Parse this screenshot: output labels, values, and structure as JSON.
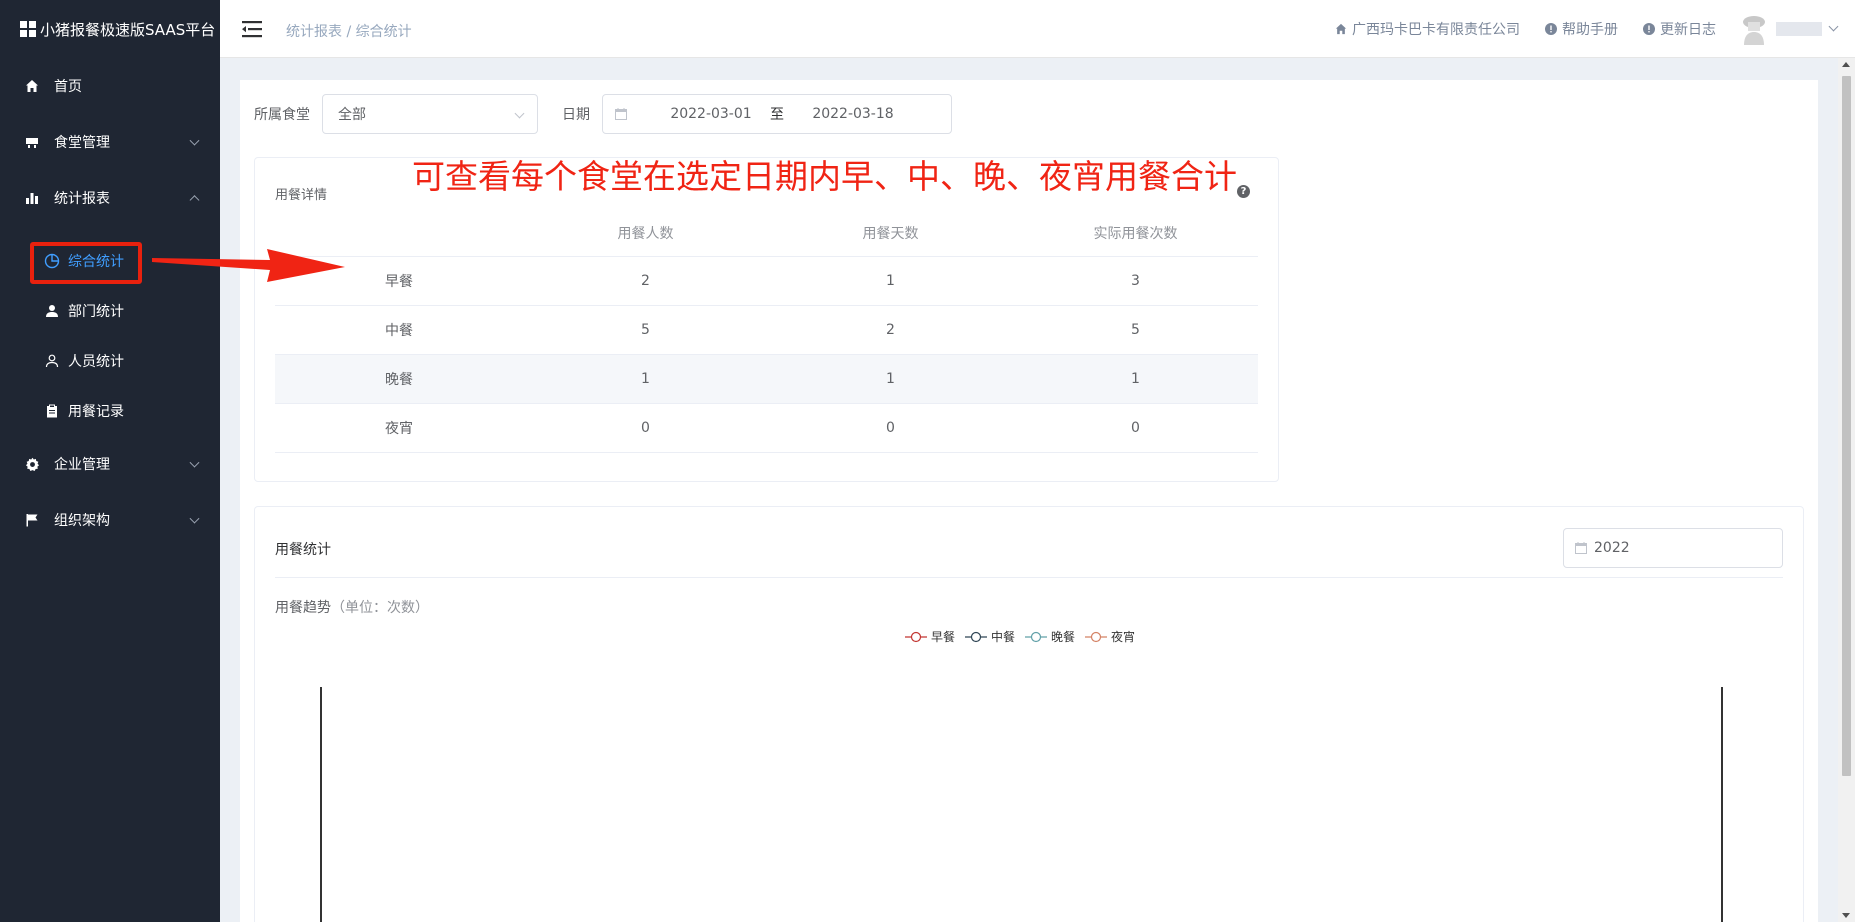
{
  "app": {
    "title": "小猪报餐极速版SAAS平台"
  },
  "sidebar": {
    "items": [
      {
        "label": "首页",
        "icon": "home-icon"
      },
      {
        "label": "食堂管理",
        "icon": "canteen-icon"
      },
      {
        "label": "统计报表",
        "icon": "bar-chart-icon"
      },
      {
        "label": "企业管理",
        "icon": "gear-icon"
      },
      {
        "label": "组织架构",
        "icon": "flag-icon"
      }
    ],
    "subitems": [
      {
        "label": "综合统计",
        "icon": "pie-chart-icon",
        "active": true
      },
      {
        "label": "部门统计",
        "icon": "user-filled-icon"
      },
      {
        "label": "人员统计",
        "icon": "user-outline-icon"
      },
      {
        "label": "用餐记录",
        "icon": "clipboard-icon"
      }
    ]
  },
  "header": {
    "breadcrumb": "统计报表 / 综合统计",
    "company": "广西玛卡巴卡有限责任公司",
    "help": "帮助手册",
    "changelog": "更新日志"
  },
  "filters": {
    "canteen_label": "所属食堂",
    "canteen_value": "全部",
    "date_label": "日期",
    "date_start": "2022-03-01",
    "date_sep": "至",
    "date_end": "2022-03-18"
  },
  "annotation": "可查看每个食堂在选定日期内早、中、晚、夜宵用餐合计",
  "detail": {
    "title": "用餐详情",
    "columns": [
      "",
      "用餐人数",
      "用餐天数",
      "实际用餐次数"
    ],
    "rows": [
      {
        "meal": "早餐",
        "people": "2",
        "days": "1",
        "times": "3"
      },
      {
        "meal": "中餐",
        "people": "5",
        "days": "2",
        "times": "5"
      },
      {
        "meal": "晚餐",
        "people": "1",
        "days": "1",
        "times": "1"
      },
      {
        "meal": "夜宵",
        "people": "0",
        "days": "0",
        "times": "0"
      }
    ]
  },
  "stats": {
    "title": "用餐统计",
    "year": "2022",
    "chart_title": "用餐趋势",
    "chart_unit": "（单位：次数）",
    "legend": [
      {
        "name": "早餐",
        "color": "#c23531"
      },
      {
        "name": "中餐",
        "color": "#2f4554"
      },
      {
        "name": "晚餐",
        "color": "#61a0a8"
      },
      {
        "name": "夜宵",
        "color": "#d48265"
      }
    ]
  },
  "colors": {
    "sidebar_bg": "#1f2633",
    "active": "#409eff",
    "annotation": "#f02414"
  }
}
